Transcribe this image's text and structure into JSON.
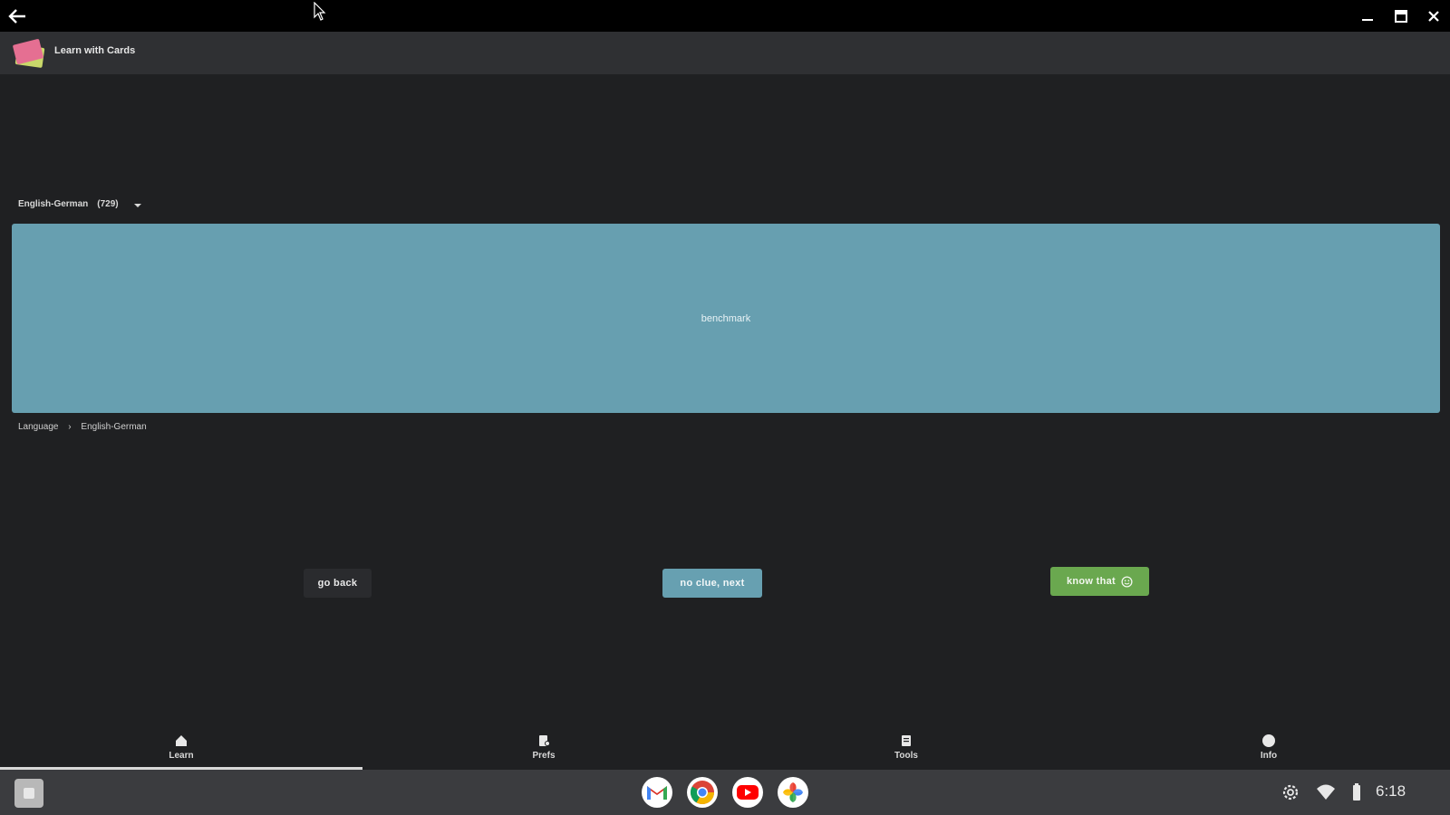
{
  "window": {
    "title": ""
  },
  "app": {
    "title": "Learn with Cards"
  },
  "deck": {
    "name": "English-German",
    "count": "(729)"
  },
  "card": {
    "word": "benchmark"
  },
  "category": {
    "parent": "Language",
    "separator": "›",
    "child": "English-German"
  },
  "buttons": {
    "go_back": "go back",
    "next": "no clue, next",
    "know": "know that"
  },
  "nav": [
    {
      "label": "Learn",
      "icon": "home-icon",
      "active": true
    },
    {
      "label": "Prefs",
      "icon": "settings-icon",
      "active": false
    },
    {
      "label": "Tools",
      "icon": "tools-icon",
      "active": false
    },
    {
      "label": "Info",
      "icon": "info-icon",
      "active": false
    }
  ],
  "shelf": {
    "apps": [
      "gmail-icon",
      "chrome-icon",
      "youtube-icon",
      "photos-icon"
    ],
    "time": "6:18"
  },
  "colors": {
    "card": "#679fb0",
    "know_button": "#6aa84f",
    "background": "#1f2022"
  }
}
